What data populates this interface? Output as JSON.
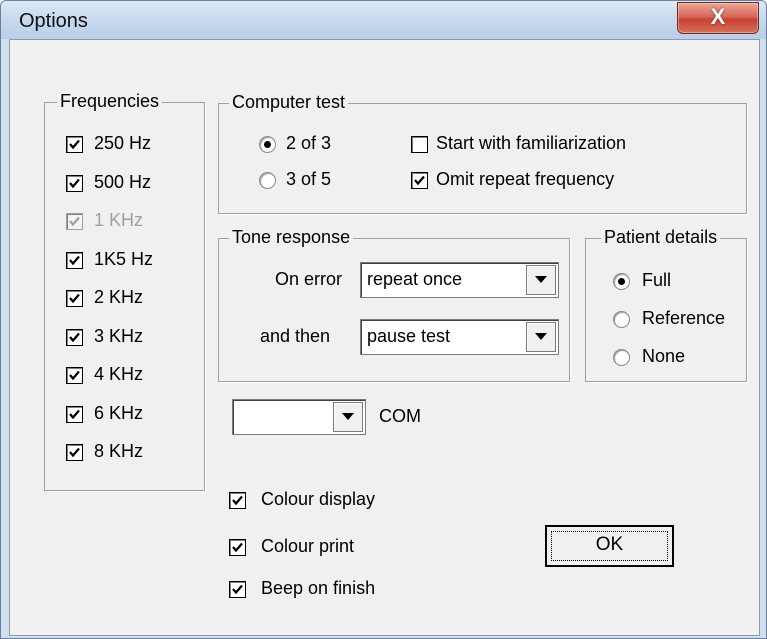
{
  "window": {
    "title": "Options",
    "close_label": "X"
  },
  "frequencies": {
    "legend": "Frequencies",
    "items": [
      {
        "label": "250 Hz",
        "checked": true,
        "disabled": false
      },
      {
        "label": "500 Hz",
        "checked": true,
        "disabled": false
      },
      {
        "label": "1 KHz",
        "checked": true,
        "disabled": true
      },
      {
        "label": "1K5 Hz",
        "checked": true,
        "disabled": false
      },
      {
        "label": "2 KHz",
        "checked": true,
        "disabled": false
      },
      {
        "label": "3 KHz",
        "checked": true,
        "disabled": false
      },
      {
        "label": "4 KHz",
        "checked": true,
        "disabled": false
      },
      {
        "label": "6 KHz",
        "checked": true,
        "disabled": false
      },
      {
        "label": "8 KHz",
        "checked": true,
        "disabled": false
      }
    ]
  },
  "computer_test": {
    "legend": "Computer test",
    "radio_2of3": "2 of 3",
    "radio_3of5": "3 of 5",
    "selected": "2 of 3",
    "familiarization_label": "Start with familiarization",
    "familiarization_checked": false,
    "omit_repeat_label": "Omit repeat frequency",
    "omit_repeat_checked": true
  },
  "tone_response": {
    "legend": "Tone response",
    "on_error_label": "On error",
    "on_error_value": "repeat once",
    "and_then_label": "and then",
    "and_then_value": "pause test"
  },
  "patient_details": {
    "legend": "Patient details",
    "options": [
      "Full",
      "Reference",
      "None"
    ],
    "selected": "Full"
  },
  "com": {
    "value": "",
    "label": "COM"
  },
  "display": {
    "colour_display_label": "Colour display",
    "colour_display_checked": true,
    "colour_print_label": "Colour print",
    "colour_print_checked": true,
    "beep_label": "Beep on finish",
    "beep_checked": true
  },
  "buttons": {
    "ok_label": "OK"
  }
}
